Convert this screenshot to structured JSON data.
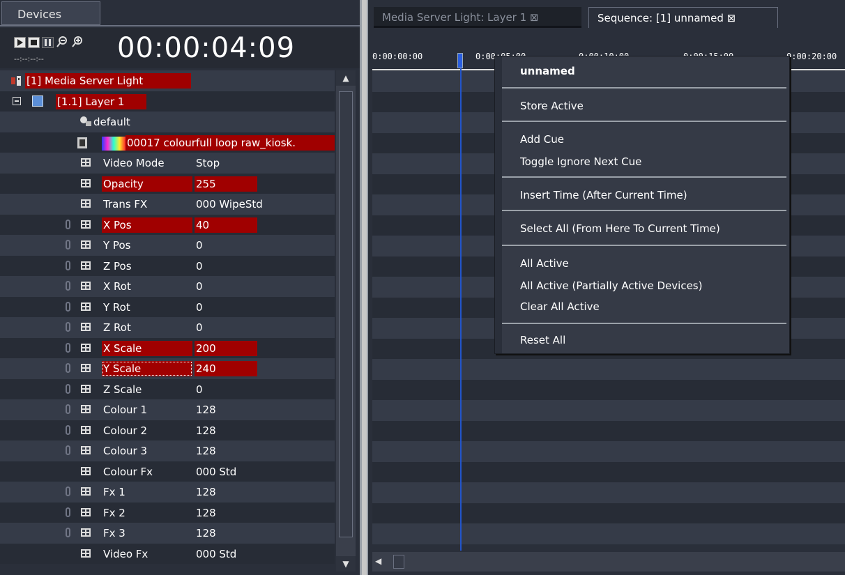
{
  "left_panel": {
    "tab_label": "Devices",
    "timecode": "00:00:04:09",
    "timecode_small": "--:--:--:--",
    "device_label": "[1] Media Server Light",
    "layer_label": "[1.1] Layer 1",
    "default_label": "default",
    "media_label": "00017 colourfull loop raw_kiosk.",
    "params": [
      {
        "name": "Video Mode",
        "value": "Stop",
        "linked": false,
        "highlight": false
      },
      {
        "name": "Opacity",
        "value": "255",
        "linked": false,
        "highlight": true
      },
      {
        "name": "Trans FX",
        "value": "000 WipeStd",
        "linked": false,
        "highlight": false
      },
      {
        "name": "X Pos",
        "value": "40",
        "linked": true,
        "highlight": true
      },
      {
        "name": "Y Pos",
        "value": "0",
        "linked": true,
        "highlight": false
      },
      {
        "name": "Z Pos",
        "value": "0",
        "linked": true,
        "highlight": false
      },
      {
        "name": "X Rot",
        "value": "0",
        "linked": true,
        "highlight": false
      },
      {
        "name": "Y Rot",
        "value": "0",
        "linked": true,
        "highlight": false
      },
      {
        "name": "Z Rot",
        "value": "0",
        "linked": true,
        "highlight": false
      },
      {
        "name": "X Scale",
        "value": "200",
        "linked": true,
        "highlight": true
      },
      {
        "name": "Y Scale",
        "value": "240",
        "linked": true,
        "highlight": true
      },
      {
        "name": "Z Scale",
        "value": "0",
        "linked": true,
        "highlight": false
      },
      {
        "name": "Colour 1",
        "value": "128",
        "linked": true,
        "highlight": false
      },
      {
        "name": "Colour 2",
        "value": "128",
        "linked": true,
        "highlight": false
      },
      {
        "name": "Colour 3",
        "value": "128",
        "linked": true,
        "highlight": false
      },
      {
        "name": "Colour Fx",
        "value": "000 Std",
        "linked": false,
        "highlight": false
      },
      {
        "name": "Fx 1",
        "value": "128",
        "linked": true,
        "highlight": false
      },
      {
        "name": "Fx 2",
        "value": "128",
        "linked": true,
        "highlight": false
      },
      {
        "name": "Fx 3",
        "value": "128",
        "linked": true,
        "highlight": false
      },
      {
        "name": "Video Fx",
        "value": "000 Std",
        "linked": false,
        "highlight": false
      }
    ]
  },
  "right_panel": {
    "tabs": [
      {
        "label": "Media Server Light: Layer 1 ⊠",
        "active": false
      },
      {
        "label": "Sequence: [1] unnamed ⊠",
        "active": true
      }
    ],
    "ruler_ticks": [
      "0:00:00:00",
      "0:00:05:00",
      "0:00:10:00",
      "0:00:15:00",
      "0:00:20:00"
    ]
  },
  "context_menu": {
    "title": "unnamed",
    "groups": [
      [
        "Store Active"
      ],
      [
        "Add Cue",
        "Toggle Ignore Next Cue"
      ],
      [
        "Insert Time (After Current Time)"
      ],
      [
        "Select All (From Here To Current Time)"
      ],
      [
        "All Active",
        "All Active (Partially Active Devices)",
        "Clear All Active"
      ],
      [
        "Reset All"
      ]
    ]
  },
  "colors": {
    "highlight": "#a00000",
    "row_light": "#353b48",
    "row_dark": "#272c36",
    "cursor": "#2255cc"
  },
  "icons": {
    "transport": [
      "play-icon",
      "stop-icon",
      "pause-icon",
      "zoom-out-icon",
      "zoom-in-icon"
    ],
    "param": "expand-box-icon",
    "link": "link-icon"
  }
}
